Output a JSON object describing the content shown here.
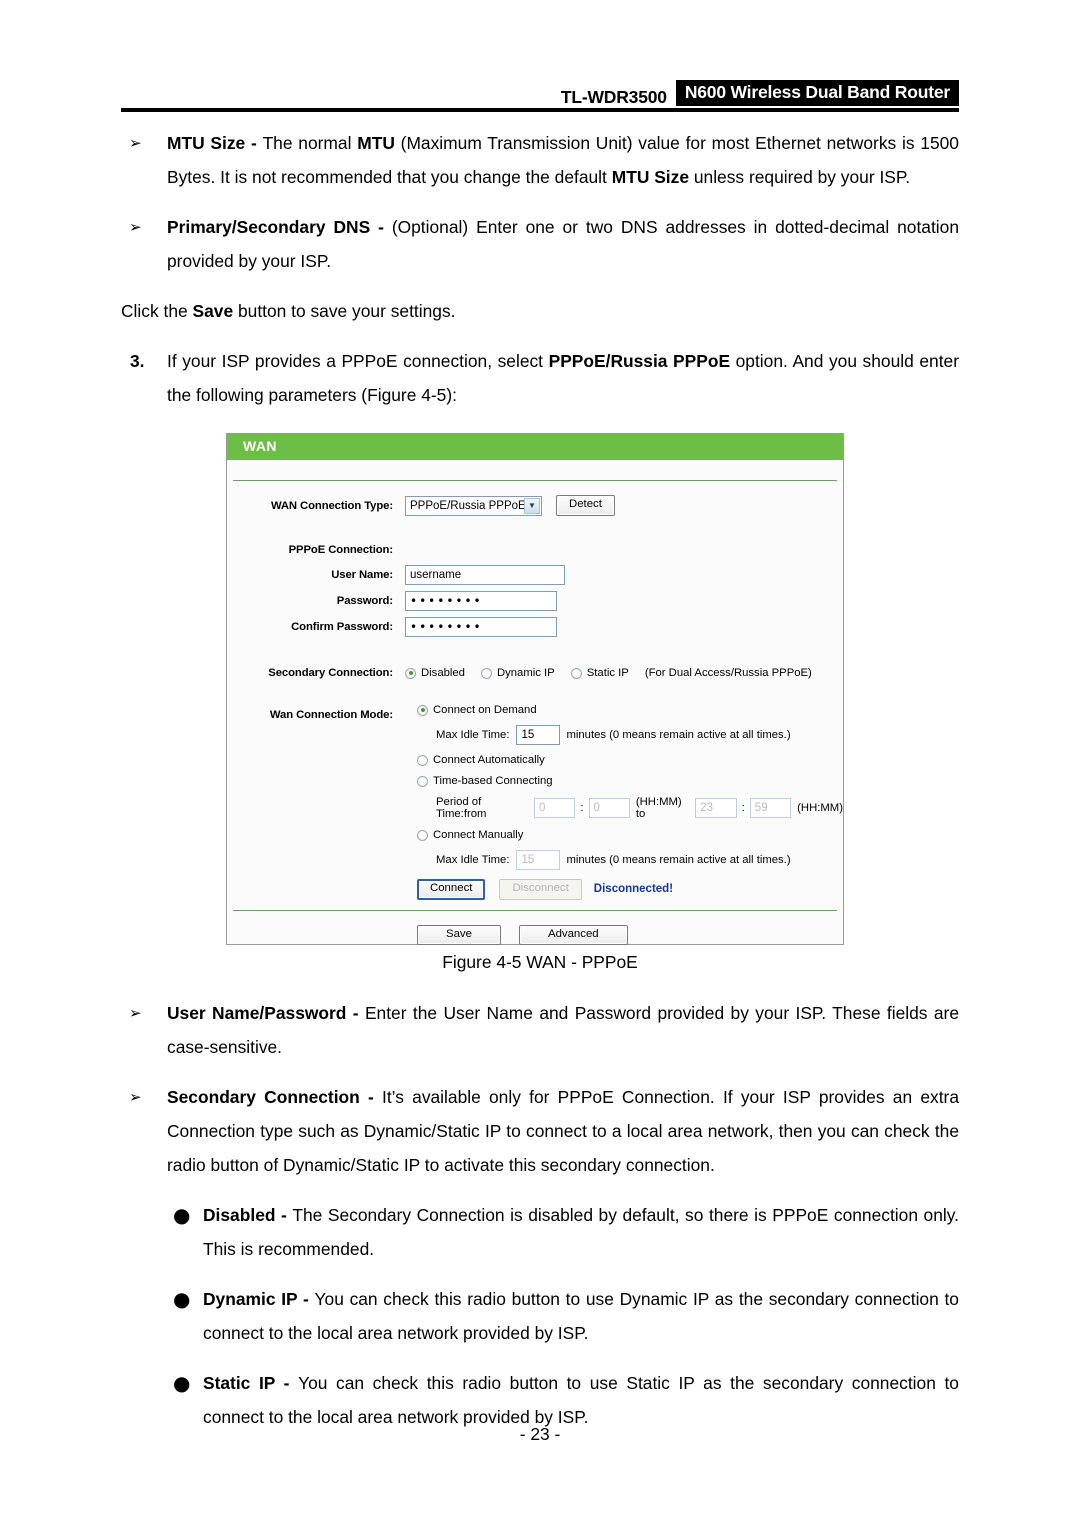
{
  "header": {
    "model": "TL-WDR3500",
    "badge": "N600 Wireless Dual Band Router"
  },
  "body": {
    "bullet_mtu_bold": "MTU Size - ",
    "bullet_mtu_rest_1": "The normal ",
    "bullet_mtu_bold_2": "MTU",
    "bullet_mtu_rest_2": " (Maximum Transmission Unit) value for most Ethernet networks is 1500 Bytes. It is not recommended that you change the default ",
    "bullet_mtu_bold_3": "MTU Size",
    "bullet_mtu_rest_3": " unless required by your ISP.",
    "bullet_dns_bold": "Primary/Secondary DNS - ",
    "bullet_dns_rest": "(Optional) Enter one or two DNS addresses in dotted-decimal notation provided by your ISP.",
    "click_save_pre": "Click the ",
    "click_save_bold": "Save",
    "click_save_post": " button to save your settings.",
    "step3_marker": "3.",
    "step3_pre": "If your ISP provides a PPPoE connection, select ",
    "step3_bold": "PPPoE/Russia PPPoE",
    "step3_post": " option. And you should enter the following parameters (Figure 4-5):",
    "figure_caption": "Figure 4-5 WAN - PPPoE",
    "bullet_userpass_bold": "User Name/Password - ",
    "bullet_userpass_rest": "Enter the User Name and Password provided by your ISP. These fields are case-sensitive.",
    "bullet_secondary_bold": "Secondary Connection - ",
    "bullet_secondary_rest": "It’s available only for PPPoE Connection. If your ISP provides an extra Connection type such as Dynamic/Static IP to connect to a local area network, then you can check the radio button of Dynamic/Static IP to activate this secondary connection.",
    "sub_disabled_bold": "Disabled - ",
    "sub_disabled_rest": "The Secondary Connection is disabled by default, so there is PPPoE connection only. This is recommended.",
    "sub_dynamic_bold": "Dynamic IP - ",
    "sub_dynamic_rest": "You can check this radio button to use Dynamic IP as the secondary connection to connect to the local area network provided by ISP.",
    "sub_static_bold": "Static IP - ",
    "sub_static_rest": "You can check this radio button to use Static IP as the secondary connection to connect to the local area network provided by ISP.",
    "arrow_marker": "➢",
    "dot_marker": "●",
    "page_number": "- 23 -"
  },
  "wan_panel": {
    "title": "WAN",
    "connection_type_label": "WAN Connection Type:",
    "connection_type_value": "PPPoE/Russia PPPoE",
    "detect_button": "Detect",
    "pppoe_connection_label": "PPPoE Connection:",
    "username_label": "User Name:",
    "username_value": "username",
    "password_label": "Password:",
    "password_value": "••••••••",
    "confirm_password_label": "Confirm Password:",
    "confirm_password_value": "••••••••",
    "secondary_connection_label": "Secondary Connection:",
    "secondary_options": [
      {
        "label": "Disabled",
        "selected": true
      },
      {
        "label": "Dynamic IP",
        "selected": false
      },
      {
        "label": "Static IP",
        "selected": false
      }
    ],
    "secondary_note": "(For Dual Access/Russia PPPoE)",
    "wan_mode_label": "Wan Connection Mode:",
    "mode_connect_on_demand": "Connect on Demand",
    "max_idle_time_label": "Max Idle Time:",
    "max_idle_time_value": "15",
    "max_idle_suffix": "minutes (0 means remain active at all times.)",
    "mode_connect_automatically": "Connect Automatically",
    "mode_time_based": "Time-based Connecting",
    "period_label": "Period of Time:from",
    "period_from_hh": "0",
    "period_from_mm": "0",
    "period_hhmm_1": "(HH:MM) to",
    "period_to_hh": "23",
    "period_to_mm": "59",
    "period_hhmm_2": "(HH:MM)",
    "mode_connect_manually": "Connect Manually",
    "max_idle_time_label_2": "Max Idle Time:",
    "max_idle_time_value_2": "15",
    "max_idle_suffix_2": "minutes (0 means remain active at all times.)",
    "connect_button": "Connect",
    "disconnect_button": "Disconnect",
    "status": "Disconnected!",
    "save_button": "Save",
    "advanced_button": "Advanced",
    "colon": ":",
    "accent_green": "#6cbe45",
    "status_color": "#11369e"
  }
}
